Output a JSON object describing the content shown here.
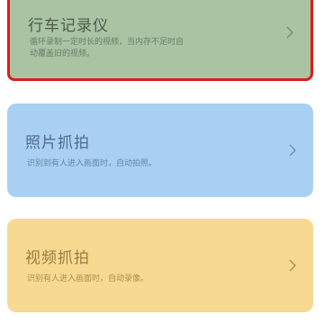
{
  "cards": [
    {
      "title": "行车记录仪",
      "description": "循环录制一定时长的视频，当内存不足时自动覆盖旧的视频。",
      "icon": "chevron-right-icon",
      "background": "#a9c3a3"
    },
    {
      "title": "照片抓拍",
      "description": "识别到有人进入画面时，自动拍照。",
      "icon": "chevron-right-icon",
      "background": "#a9d0f2"
    },
    {
      "title": "视频抓拍",
      "description": "识别有人进入画面时，自动录像。",
      "icon": "chevron-right-icon",
      "background": "#f7d991"
    }
  ],
  "colors": {
    "highlight_border": "#e01c1c",
    "page_background": "#ffffff"
  }
}
